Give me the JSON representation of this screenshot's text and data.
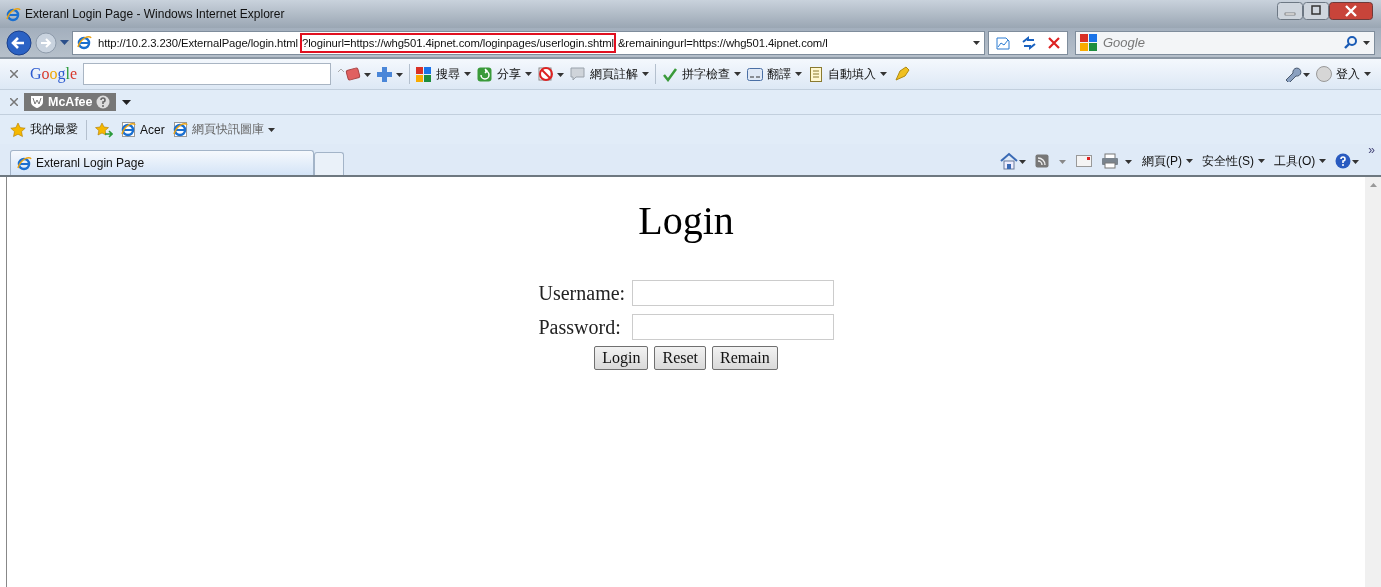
{
  "window": {
    "title": "Exteranl Login Page - Windows Internet Explorer"
  },
  "address_bar": {
    "url_parts": [
      {
        "text": "http://10.2.3.230/ExternalPage/login.html",
        "highlighted": false
      },
      {
        "text": "?loginurl=https://whg501.4ipnet.com/loginpages/userlogin.shtml",
        "highlighted": true
      },
      {
        "text": "&remainingurl=https://whg501.4ipnet.com/l",
        "highlighted": false
      }
    ]
  },
  "search_box": {
    "placeholder": "Google"
  },
  "google_toolbar": {
    "logo": "Google",
    "items": [
      {
        "label": "搜尋",
        "kind": "search"
      },
      {
        "label": "分享",
        "kind": "share"
      },
      {
        "label": "網頁註解",
        "kind": "note"
      },
      {
        "label": "拼字檢查",
        "kind": "spell"
      },
      {
        "label": "翻譯",
        "kind": "translate"
      },
      {
        "label": "自動填入",
        "kind": "autofill"
      }
    ],
    "sign_in": "登入"
  },
  "mcafee_bar": {
    "label": "McAfee"
  },
  "favorites_bar": {
    "favorites": "我的最愛",
    "links": [
      {
        "label": "Acer",
        "disabled": false
      },
      {
        "label": "網頁快訊圖庫",
        "disabled": true
      }
    ]
  },
  "tabs": [
    {
      "label": "Exteranl Login Page",
      "selected": true
    }
  ],
  "command_bar": {
    "menus": [
      "網頁(P)",
      "安全性(S)",
      "工具(O)"
    ],
    "overflow": "»"
  },
  "page": {
    "heading": "Login",
    "fields": [
      {
        "label": "Username:"
      },
      {
        "label": "Password:"
      }
    ],
    "buttons": [
      "Login",
      "Reset",
      "Remain"
    ]
  }
}
